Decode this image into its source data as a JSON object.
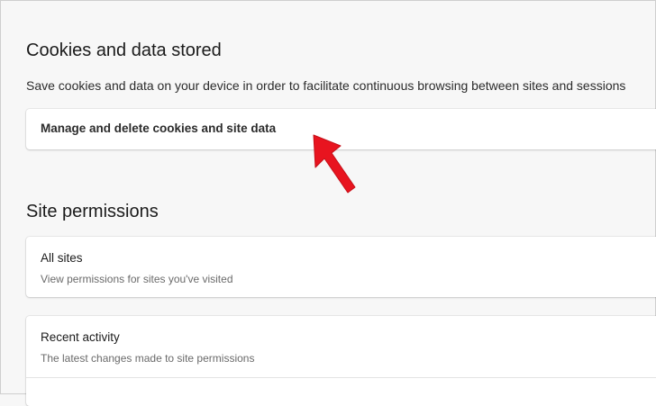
{
  "cookies_section": {
    "title": "Cookies and data stored",
    "description": "Save cookies and data on your device in order to facilitate continuous browsing between sites and sessions",
    "manage_item": {
      "label": "Manage and delete cookies and site data"
    }
  },
  "permissions_section": {
    "title": "Site permissions",
    "all_sites": {
      "title": "All sites",
      "subtitle": "View permissions for sites you've visited"
    },
    "recent_activity": {
      "title": "Recent activity",
      "subtitle": "The latest changes made to site permissions"
    }
  },
  "annotation": {
    "arrow_icon": "red-arrow-pointer-icon",
    "arrow_color": "#e8141f"
  }
}
